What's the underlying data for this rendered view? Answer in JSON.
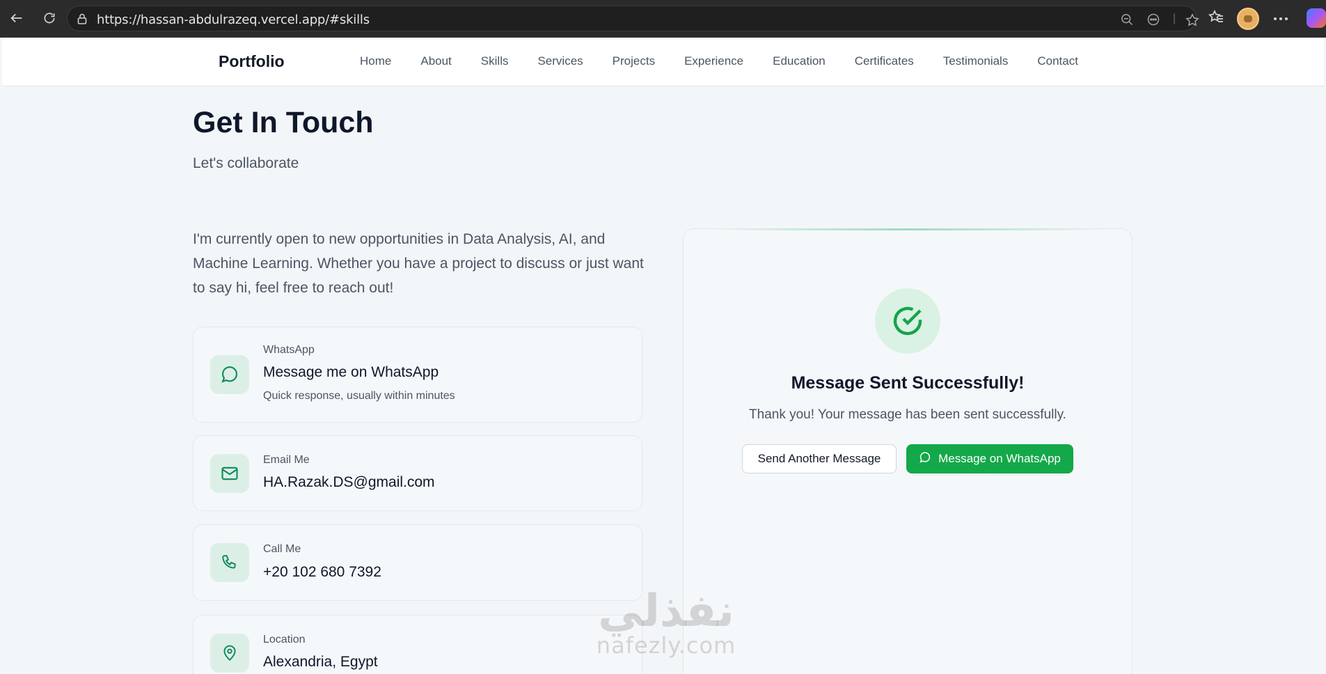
{
  "browser": {
    "url": "https://hassan-abdulrazeq.vercel.app/#skills",
    "icons": [
      "back-icon",
      "reload-icon",
      "lock-icon",
      "zoom-icon",
      "reading-icon",
      "star-icon",
      "favorites-icon",
      "profile-avatar",
      "more-icon",
      "copilot-icon"
    ]
  },
  "navbar": {
    "brand": "Portfolio",
    "links": [
      "Home",
      "About",
      "Skills",
      "Services",
      "Projects",
      "Experience",
      "Education",
      "Certificates",
      "Testimonials",
      "Contact"
    ]
  },
  "contact": {
    "title": "Get In Touch",
    "subtitle": "Let's collaborate",
    "intro": "I'm currently open to new opportunities in Data Analysis, AI, and Machine Learning. Whether you have a project to discuss or just want to say hi, feel free to reach out!",
    "cards": [
      {
        "label": "WhatsApp",
        "value": "Message me on WhatsApp",
        "note": "Quick response, usually within minutes",
        "icon": "whatsapp-icon"
      },
      {
        "label": "Email Me",
        "value": "HA.Razak.DS@gmail.com",
        "icon": "mail-icon"
      },
      {
        "label": "Call Me",
        "value": "+20 102 680 7392",
        "icon": "phone-icon"
      },
      {
        "label": "Location",
        "value": "Alexandria, Egypt",
        "icon": "map-pin-icon"
      }
    ]
  },
  "success": {
    "title": "Message Sent Successfully!",
    "text": "Thank you! Your message has been sent successfully.",
    "send_another": "Send Another Message",
    "whatsapp_button": "Message on WhatsApp",
    "icon": "check-circle-icon"
  },
  "watermark": {
    "arabic": "نفذلي",
    "latin": "nafezly.com"
  },
  "colors": {
    "accent_green": "#13a84a",
    "icon_teal": "#0c8a5a",
    "icon_bg": "#dcefe6"
  }
}
